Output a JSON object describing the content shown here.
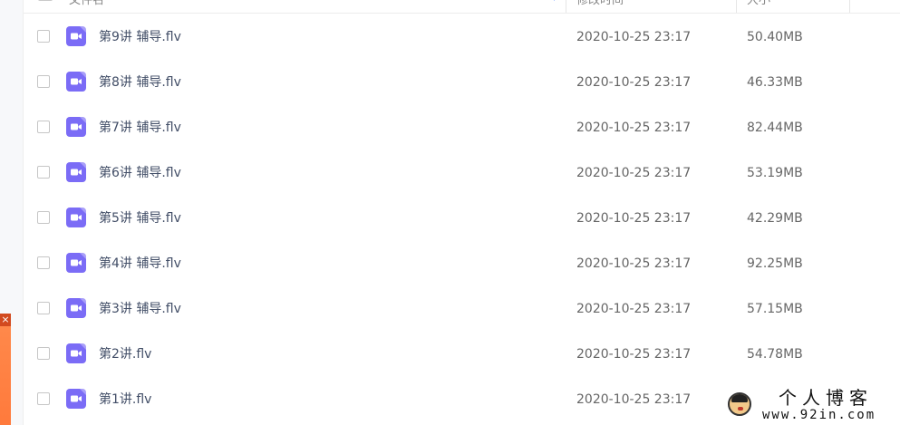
{
  "header": {
    "name_label": "文件名",
    "modified_label": "修改时间",
    "size_label": "大小"
  },
  "files": [
    {
      "name": "第9讲 辅导.flv",
      "modified": "2020-10-25 23:17",
      "size": "50.40MB"
    },
    {
      "name": "第8讲 辅导.flv",
      "modified": "2020-10-25 23:17",
      "size": "46.33MB"
    },
    {
      "name": "第7讲 辅导.flv",
      "modified": "2020-10-25 23:17",
      "size": "82.44MB"
    },
    {
      "name": "第6讲 辅导.flv",
      "modified": "2020-10-25 23:17",
      "size": "53.19MB"
    },
    {
      "name": "第5讲 辅导.flv",
      "modified": "2020-10-25 23:17",
      "size": "42.29MB"
    },
    {
      "name": "第4讲 辅导.flv",
      "modified": "2020-10-25 23:17",
      "size": "92.25MB"
    },
    {
      "name": "第3讲 辅导.flv",
      "modified": "2020-10-25 23:17",
      "size": "57.15MB"
    },
    {
      "name": "第2讲.flv",
      "modified": "2020-10-25 23:17",
      "size": "54.78MB"
    },
    {
      "name": "第1讲.flv",
      "modified": "2020-10-25 23:17",
      "size": ""
    }
  ],
  "icons": {
    "file_icon": "video-file-icon",
    "close_icon": "close-icon",
    "sort_icon": "chevron-down-icon"
  },
  "side_panel": {
    "close_glyph": "×"
  },
  "watermark": {
    "title": "个人博客",
    "url": "www.92in.com"
  },
  "colors": {
    "file_icon_bg": "#7b6cf6",
    "accent": "#4a7dff",
    "side_tab": "#ff7a3c"
  }
}
